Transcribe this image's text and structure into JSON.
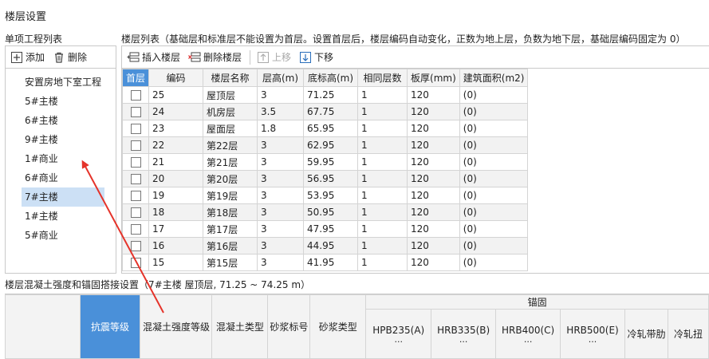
{
  "window": {
    "title": "楼层设置"
  },
  "left_panel": {
    "label": "单项工程列表",
    "add_label": "添加",
    "delete_label": "删除",
    "items": [
      "安置房地下室工程",
      "5#主楼",
      "6#主楼",
      "9#主楼",
      "1#商业",
      "6#商业",
      "7#主楼",
      "1#主楼",
      "5#商业"
    ],
    "selected_index": 6
  },
  "right_panel": {
    "label": "楼层列表（基础层和标准层不能设置为首层。设置首层后，楼层编码自动变化，正数为地上层，负数为地下层，基础层编码固定为 0）",
    "insert_label": "插入楼层",
    "delete_label": "删除楼层",
    "move_up_label": "上移",
    "move_down_label": "下移",
    "columns": [
      "首层",
      "编码",
      "楼层名称",
      "层高(m)",
      "底标高(m)",
      "相同层数",
      "板厚(mm)",
      "建筑面积(m2)"
    ],
    "rows": [
      [
        "25",
        "屋顶层",
        "3",
        "71.25",
        "1",
        "120",
        "(0)"
      ],
      [
        "24",
        "机房层",
        "3.5",
        "67.75",
        "1",
        "120",
        "(0)"
      ],
      [
        "23",
        "屋面层",
        "1.8",
        "65.95",
        "1",
        "120",
        "(0)"
      ],
      [
        "22",
        "第22层",
        "3",
        "62.95",
        "1",
        "120",
        "(0)"
      ],
      [
        "21",
        "第21层",
        "3",
        "59.95",
        "1",
        "120",
        "(0)"
      ],
      [
        "20",
        "第20层",
        "3",
        "56.95",
        "1",
        "120",
        "(0)"
      ],
      [
        "19",
        "第19层",
        "3",
        "53.95",
        "1",
        "120",
        "(0)"
      ],
      [
        "18",
        "第18层",
        "3",
        "50.95",
        "1",
        "120",
        "(0)"
      ],
      [
        "17",
        "第17层",
        "3",
        "47.95",
        "1",
        "120",
        "(0)"
      ],
      [
        "16",
        "第16层",
        "3",
        "44.95",
        "1",
        "120",
        "(0)"
      ],
      [
        "15",
        "第15层",
        "3",
        "41.95",
        "1",
        "120",
        "(0)"
      ]
    ]
  },
  "bottom_panel": {
    "label": "楼层混凝土强度和锚固搭接设置（7#主楼  屋顶层, 71.25 ~ 74.25 m）",
    "columns": [
      "抗震等级",
      "混凝土强度等级",
      "混凝土类型",
      "砂浆标号",
      "砂浆类型"
    ],
    "group_label": "锚固",
    "sub_columns": [
      "HPB235(A)",
      "HRB335(B)",
      "HRB400(C)",
      "HRB500(E)",
      "冷轧带肋",
      "冷轧扭"
    ],
    "ellipsis": "..."
  },
  "colors": {
    "header_accent": "#4a90d9",
    "selection": "#cce0f5",
    "arrow": "#e5332a"
  }
}
